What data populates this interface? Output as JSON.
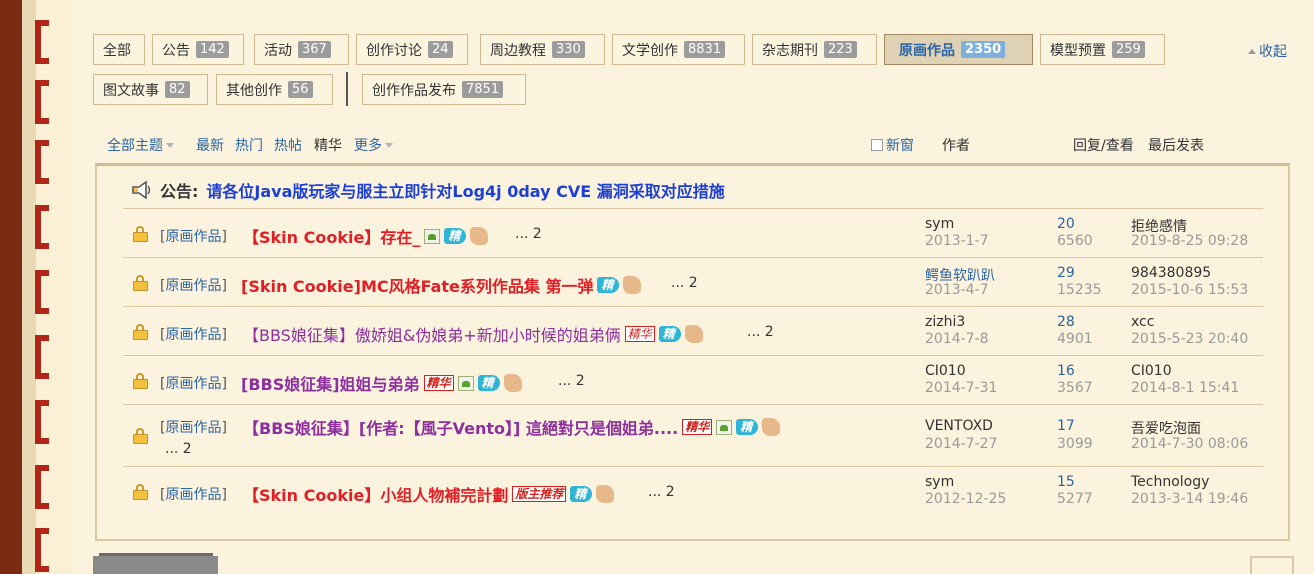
{
  "tabs": [
    {
      "label": "全部",
      "count": ""
    },
    {
      "label": "公告",
      "count": "142"
    },
    {
      "label": "活动",
      "count": "367"
    },
    {
      "label": "创作讨论",
      "count": "24"
    },
    {
      "label": "周边教程",
      "count": "330"
    },
    {
      "label": "文学创作",
      "count": "8831"
    },
    {
      "label": "杂志期刊",
      "count": "223"
    },
    {
      "label": "原画作品",
      "count": "2350",
      "active": true
    },
    {
      "label": "模型预置",
      "count": "259"
    },
    {
      "label": "图文故事",
      "count": "82"
    },
    {
      "label": "其他创作",
      "count": "56"
    },
    {
      "label": "创作作品发布",
      "count": "7851"
    }
  ],
  "collapse_label": "收起",
  "filters": {
    "all_topics": "全部主题",
    "latest": "最新",
    "hot": "热门",
    "hot_posts": "热帖",
    "digest": "精华",
    "more": "更多",
    "new_window": "新窗",
    "author": "作者",
    "reply_view": "回复/查看",
    "last_post": "最后发表"
  },
  "announcement": {
    "label": "公告:",
    "text": "请各位Java版玩家与服主立即针对Log4j 0day CVE 漏洞采取对应措施"
  },
  "threads": [
    {
      "category": "原画作品",
      "title": "【Skin Cookie】存在_",
      "pages": "... 2",
      "author": "sym",
      "date": "2013-1-7",
      "replies": "20",
      "views": "6560",
      "last_by": "拒绝感情",
      "last_date": "2019-8-25 09:28"
    },
    {
      "category": "原画作品",
      "title": "[Skin Cookie]MC风格Fate系列作品集 第一弹",
      "pages": "... 2",
      "author": "鳄鱼软趴趴",
      "date": "2013-4-7",
      "replies": "29",
      "views": "15235",
      "last_by": "984380895",
      "last_date": "2015-10-6 15:53"
    },
    {
      "category": "原画作品",
      "title": "【BBS娘征集】傲娇姐&伪娘弟+新加小时候的姐弟俩",
      "pages": "... 2",
      "author": "zizhi3",
      "date": "2014-7-8",
      "replies": "28",
      "views": "4901",
      "last_by": "xcc",
      "last_date": "2015-5-23 20:40"
    },
    {
      "category": "原画作品",
      "title": "[BBS娘征集]姐姐与弟弟",
      "pages": "... 2",
      "author": "CI010",
      "date": "2014-7-31",
      "replies": "16",
      "views": "3567",
      "last_by": "CI010",
      "last_date": "2014-8-1 15:41"
    },
    {
      "category": "原画作品",
      "title": "【BBS娘征集】[作者:【風子Vento】] 這絕對只是個姐弟....",
      "pages": "... 2",
      "author": "VENTOXD",
      "date": "2014-7-27",
      "replies": "17",
      "views": "3099",
      "last_by": "吾爱吃泡面",
      "last_date": "2014-7-30 08:06"
    },
    {
      "category": "原画作品",
      "title": "【Skin Cookie】小组人物補完計劃",
      "pages": "... 2",
      "author": "sym",
      "date": "2012-12-25",
      "replies": "15",
      "views": "5277",
      "last_by": "Technology",
      "last_date": "2013-3-14 19:46"
    }
  ],
  "badges": {
    "jing": "精",
    "jinghua": "精华",
    "moderator_pick": "版主推荐"
  },
  "colors": {
    "link_blue": "#2b64a6",
    "title_red": "#e01f26",
    "title_purple": "#8e2fa0",
    "announce_blue": "#1c3fd6",
    "border_brown": "#7a2a12"
  }
}
